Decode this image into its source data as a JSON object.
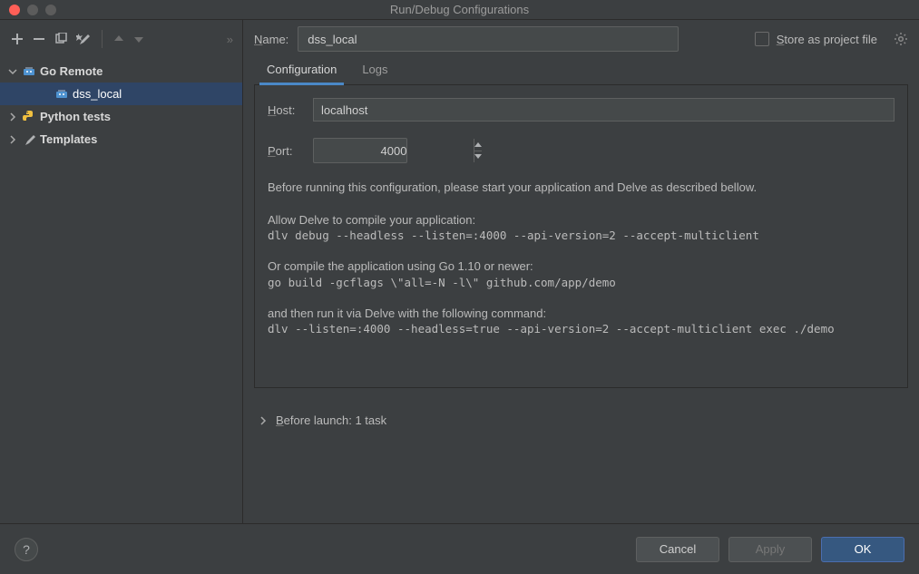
{
  "window": {
    "title": "Run/Debug Configurations"
  },
  "toolbar": {
    "add_tip": "Add new configuration",
    "remove_tip": "Remove configuration",
    "copy_tip": "Copy configuration",
    "wrench_tip": "Edit templates",
    "up_tip": "Move up",
    "down_tip": "Move down",
    "more_tip": "More"
  },
  "tree": {
    "items": [
      {
        "label": "Go Remote",
        "type": "folder",
        "expanded": true,
        "icon": "go-remote-icon"
      },
      {
        "label": "dss_local",
        "type": "config",
        "parent": 0,
        "selected": true,
        "icon": "go-remote-icon"
      },
      {
        "label": "Python tests",
        "type": "folder",
        "expanded": false,
        "icon": "python-icon"
      },
      {
        "label": "Templates",
        "type": "folder",
        "expanded": false,
        "icon": "wrench-icon"
      }
    ]
  },
  "name_row": {
    "label_html": "Name:",
    "value": "dss_local",
    "store_label": "Store as project file",
    "store_checked": false
  },
  "tabs": [
    {
      "label": "Configuration",
      "active": true
    },
    {
      "label": "Logs",
      "active": false
    }
  ],
  "config": {
    "host_label": "Host:",
    "host_value": "localhost",
    "port_label": "Port:",
    "port_value": "4000",
    "desc1": "Before running this configuration, please start your application and Delve as described bellow.",
    "desc2": "Allow Delve to compile your application:",
    "code1": "dlv debug --headless --listen=:4000 --api-version=2 --accept-multiclient",
    "desc3": "Or compile the application using Go 1.10 or newer:",
    "code2": "go build -gcflags \\\"all=-N -l\\\" github.com/app/demo",
    "desc4": "and then run it via Delve with the following command:",
    "code3": "dlv --listen=:4000 --headless=true --api-version=2 --accept-multiclient exec ./demo"
  },
  "before_launch": {
    "label": "Before launch: 1 task"
  },
  "footer": {
    "help": "?",
    "cancel": "Cancel",
    "apply": "Apply",
    "ok": "OK"
  }
}
